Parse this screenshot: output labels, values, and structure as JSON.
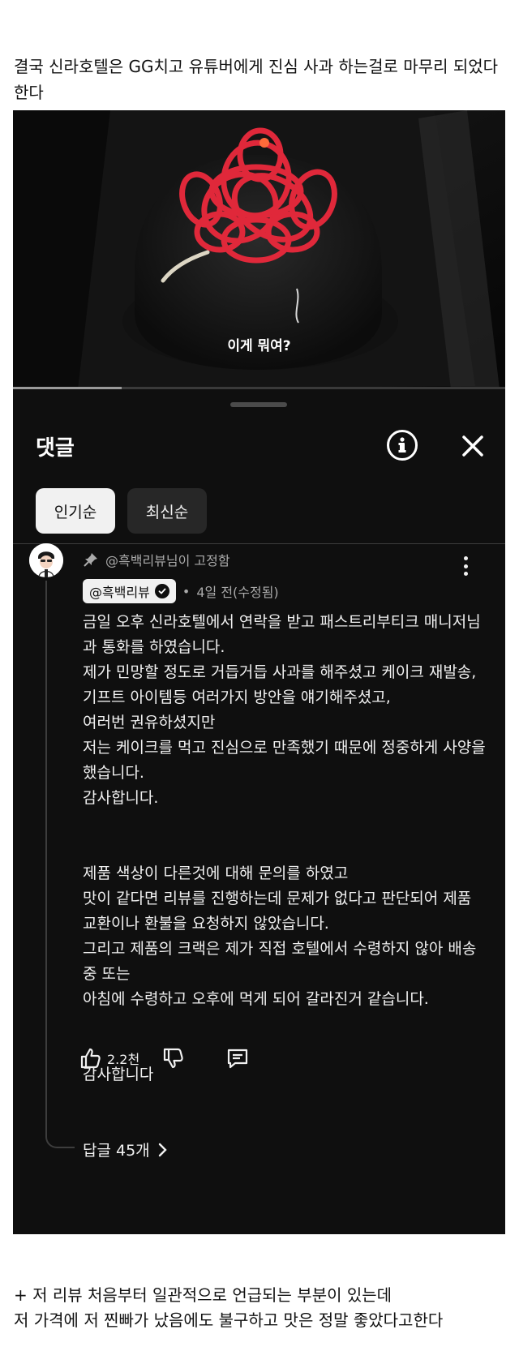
{
  "post": {
    "intro": "결국 신라호텔은 GG치고 유튜버에게 진심 사과 하는걸로 마무리 되었다 한다",
    "outro": "+ 저 리뷰 처음부터  일관적으로 언급되는 부분이 있는데\n저 가격에 저 찐빠가 났음에도 불구하고 맛은 정말 좋았다고한다"
  },
  "video": {
    "caption": "이게 뭐여?",
    "progress": 0.22
  },
  "comments_panel": {
    "title": "댓글",
    "sort_chips": [
      {
        "label": "인기순",
        "selected": true
      },
      {
        "label": "최신순",
        "selected": false
      }
    ],
    "pinned_comment": {
      "pinned_by": "@흑백리뷰님이 고정함",
      "author": "@흑백리뷰",
      "verified": true,
      "time": "4일 전(수정됨)",
      "text": "금일 오후 신라호텔에서 연락을 받고 패스트리부티크 매니저님과 통화를 하였습니다.\n제가 민망할 정도로 거듭거듭 사과를 해주셨고 케이크 재발송, 기프트 아이템등 여러가지 방안을 얘기해주셨고,\n여러번 권유하셨지만\n저는 케이크를 먹고 진심으로 만족했기 때문에 정중하게 사양을 했습니다.\n감사합니다.\n\n\n제품 색상이 다른것에 대해 문의를 하였고\n맛이 같다면 리뷰를 진행하는데 문제가 없다고 판단되어 제품 교환이나 환불을 요청하지 않았습니다.\n그리고 제품의 크랙은 제가 직접 호텔에서 수령하지 않아 배송중 또는\n아침에 수령하고 오후에 먹게 되어 갈라진거 같습니다.\n\n\n감사합니다",
      "likes": "2.2천",
      "replies": "답글 45개"
    }
  },
  "colors": {
    "panel_bg": "#0f0f0f",
    "text_light": "#f1f1f1",
    "text_muted": "#aaaaaa",
    "cake_red": "#e0283a"
  },
  "icons": [
    "info-icon",
    "close-icon",
    "pin-icon",
    "verified-check-icon",
    "more-vert-icon",
    "thumb-up-icon",
    "thumb-down-icon",
    "reply-comment-icon",
    "chevron-right-icon"
  ]
}
